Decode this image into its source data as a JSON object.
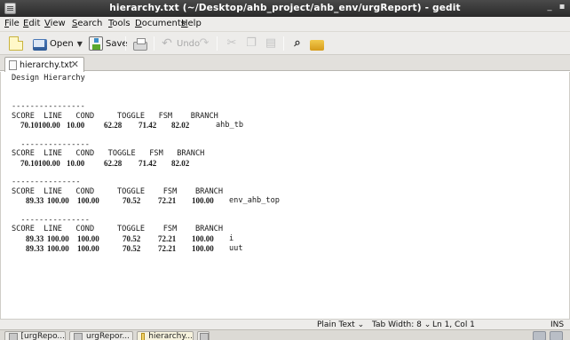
{
  "window": {
    "title": "hierarchy.txt (~/Desktop/ahb_project/ahb_env/urgReport) - gedit",
    "minimize": "_",
    "close": "▪"
  },
  "menu": {
    "items": [
      "File",
      "Edit",
      "View",
      "Search",
      "Tools",
      "Documents",
      "Help"
    ],
    "accelerators": [
      "F",
      "E",
      "V",
      "S",
      "T",
      "D",
      "H"
    ]
  },
  "toolbar": {
    "open_label": "Open",
    "save_label": "Save",
    "undo_label": "Undo"
  },
  "tab": {
    "label": "hierarchy.txt",
    "close": "✕"
  },
  "editor": {
    "lines": [
      {
        "kind": "mono",
        "text": "Design Hierarchy"
      },
      {
        "kind": "mono",
        "text": ""
      },
      {
        "kind": "mono",
        "text": ""
      },
      {
        "kind": "mono",
        "text": "----------------"
      },
      {
        "kind": "mono",
        "text": "SCORE  LINE   COND     TOGGLE   FSM    BRANCH"
      },
      {
        "kind": "row",
        "score": "70.10",
        "line": "100.00",
        "cond": "10.00",
        "toggle": "62.28",
        "fsm": "71.42",
        "branch": "82.02",
        "name": "ahb_tb"
      },
      {
        "kind": "mono",
        "text": ""
      },
      {
        "kind": "mono",
        "text": "  ---------------"
      },
      {
        "kind": "mono",
        "text": "SCORE  LINE   COND   TOGGLE   FSM   BRANCH"
      },
      {
        "kind": "row",
        "score": "70.10",
        "line": "100.00",
        "cond": "10.00",
        "toggle": "62.28",
        "fsm": "71.42",
        "branch": "82.02",
        "name": ""
      },
      {
        "kind": "mono",
        "text": ""
      },
      {
        "kind": "mono",
        "text": "---------------"
      },
      {
        "kind": "mono",
        "text": "SCORE  LINE   COND     TOGGLE    FSM    BRANCH"
      },
      {
        "kind": "row",
        "score": "89.33",
        "line": "100.00",
        "cond": "100.00",
        "toggle": "70.52",
        "fsm": "72.21",
        "branch": "100.00",
        "name": "env_ahb_top"
      },
      {
        "kind": "mono",
        "text": ""
      },
      {
        "kind": "mono",
        "text": "  ---------------"
      },
      {
        "kind": "mono",
        "text": "SCORE  LINE   COND     TOGGLE    FSM    BRANCH"
      },
      {
        "kind": "row",
        "score": "89.33",
        "line": "100.00",
        "cond": "100.00",
        "toggle": "70.52",
        "fsm": "72.21",
        "branch": "100.00",
        "name": "i"
      },
      {
        "kind": "row",
        "score": "89.33",
        "line": "100.00",
        "cond": "100.00",
        "toggle": "70.52",
        "fsm": "72.21",
        "branch": "100.00",
        "name": "uut"
      }
    ]
  },
  "statusbar": {
    "language": "Plain Text",
    "tab_width": "Tab Width: 8",
    "cursor": "Ln 1, Col 1",
    "mode": "INS"
  },
  "taskbar": {
    "tasks": [
      "[urgRepo...",
      "urgRepor...",
      "hierarchy..."
    ]
  }
}
